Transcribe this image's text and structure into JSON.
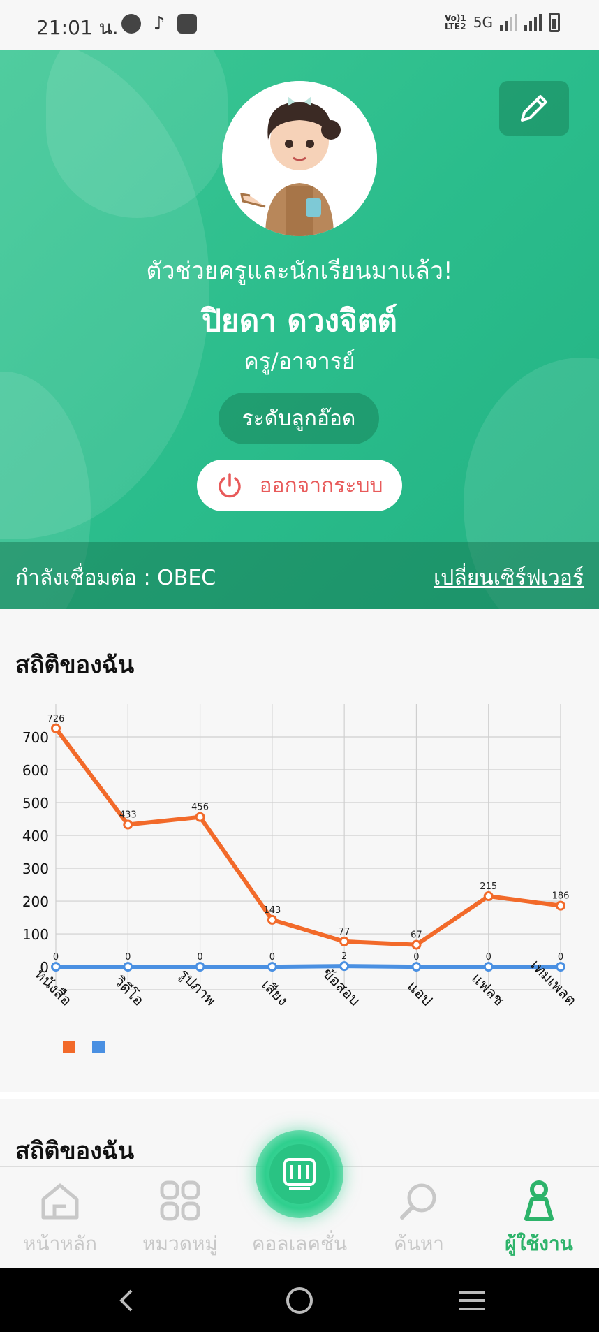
{
  "status_bar": {
    "time": "21:01 น.",
    "network": "5G",
    "lte": "Vo) 1\nLTE2"
  },
  "hero": {
    "tagline": "ตัวช่วยครูและนักเรียนมาแล้ว!",
    "name": "ปิยดา ดวงจิตต์",
    "role": "ครู/อาจารย์",
    "level": "ระดับลูกอ๊อด",
    "logout_label": "ออกจากระบบ",
    "server_label": "กำลังเชื่อมต่อ : OBEC",
    "server_change": "เปลี่ยนเซิร์ฟเวอร์"
  },
  "stats": {
    "title": "สถิติของฉัน",
    "title2": "สถิติของฉัน"
  },
  "colors": {
    "primary": "#2bbd8c",
    "orange": "#f26a2a",
    "blue": "#4a90e2",
    "logout_red": "#e85a5a",
    "active_nav": "#2db36a"
  },
  "chart_data": {
    "type": "line",
    "categories": [
      "หนังสือ",
      "วิดีโอ",
      "รูปภาพ",
      "เสียง",
      "ข้อสอบ",
      "แอป",
      "แฟลช",
      "เทมเพลต"
    ],
    "series": [
      {
        "color": "#f26a2a",
        "values": [
          726,
          433,
          456,
          143,
          77,
          67,
          215,
          186
        ]
      },
      {
        "color": "#4a90e2",
        "values": [
          0,
          0,
          0,
          0,
          2,
          0,
          0,
          0
        ]
      }
    ],
    "y_ticks": [
      0,
      100,
      200,
      300,
      400,
      500,
      600,
      700
    ],
    "ylim": [
      -70,
      800
    ],
    "grid": true,
    "data_labels": true
  },
  "bottom_nav": [
    {
      "label": "หน้าหลัก",
      "icon": "home-icon"
    },
    {
      "label": "หมวดหมู่",
      "icon": "category-icon"
    },
    {
      "label": "คอลเลคชั่น",
      "icon": "collection-icon"
    },
    {
      "label": "ค้นหา",
      "icon": "search-icon"
    },
    {
      "label": "ผู้ใช้งาน",
      "icon": "user-icon",
      "active": true
    }
  ]
}
